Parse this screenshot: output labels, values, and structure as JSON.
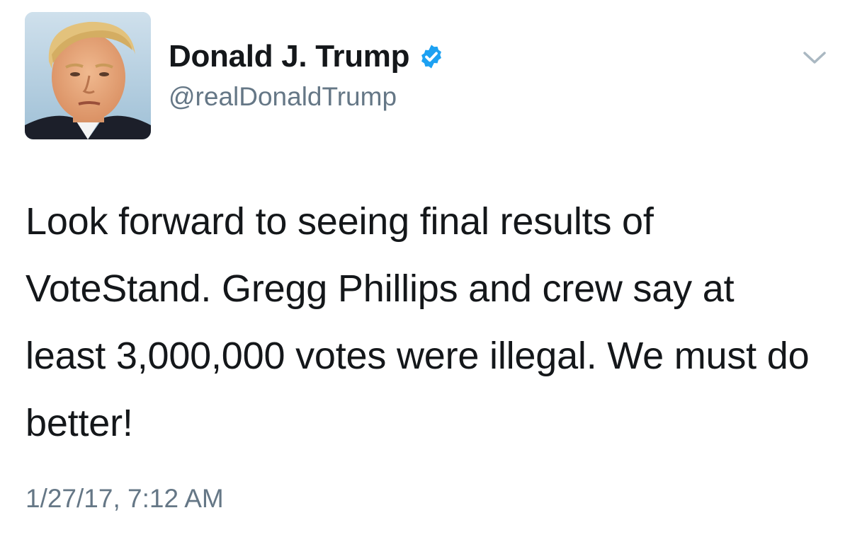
{
  "tweet": {
    "author": {
      "display_name": "Donald J. Trump",
      "handle": "@realDonaldTrump",
      "verified": true
    },
    "text": "Look forward to seeing final results of VoteStand. Gregg Phillips and crew say at least 3,000,000 votes were illegal. We must do better!",
    "timestamp": "1/27/17, 7:12 AM"
  },
  "colors": {
    "verified_blue": "#1da1f2",
    "text_primary": "#14171a",
    "text_secondary": "#657786",
    "caret": "#aab8c2"
  },
  "icons": {
    "verified": "verified-badge-icon",
    "caret": "chevron-down-icon",
    "avatar": "profile-photo"
  }
}
